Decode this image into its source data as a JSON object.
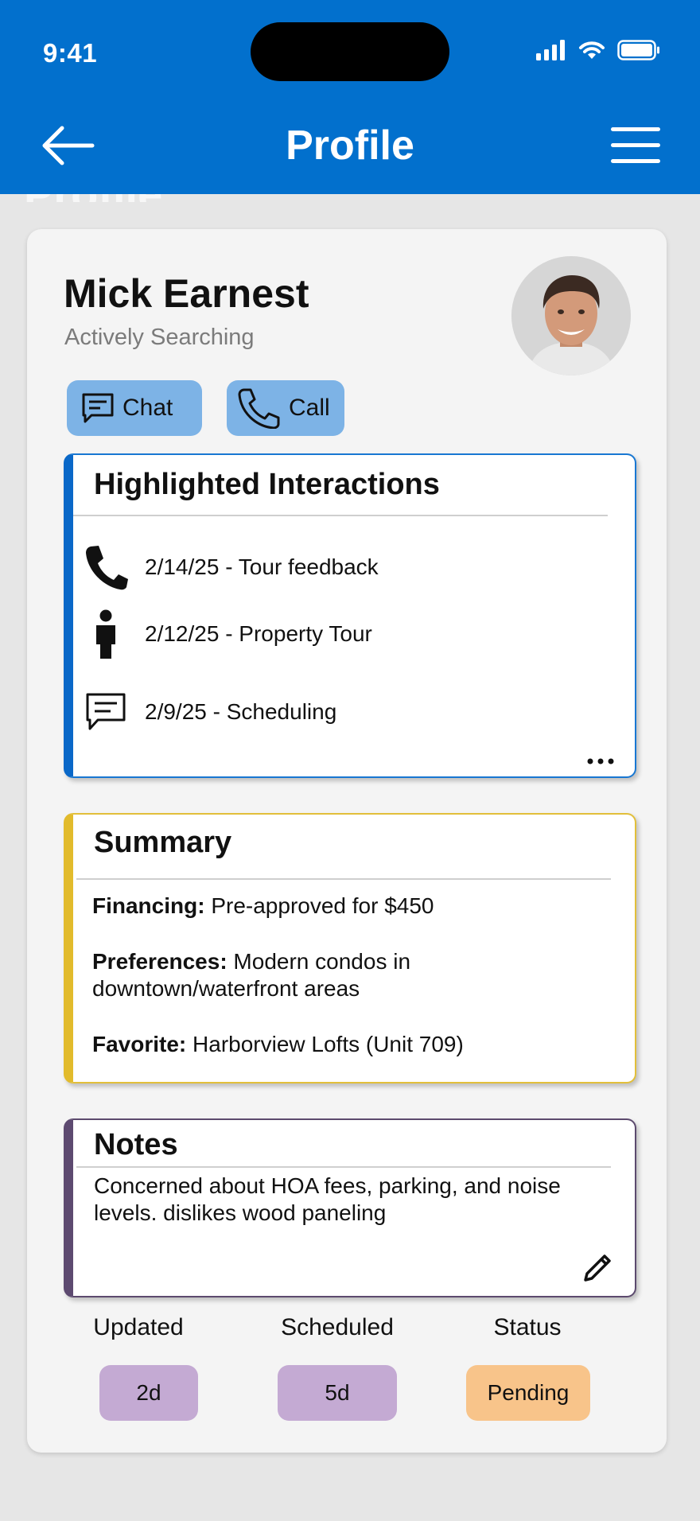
{
  "status_bar": {
    "time": "9:41"
  },
  "header": {
    "title": "Profile",
    "ghost_title": "Profile"
  },
  "profile": {
    "name": "Mick Earnest",
    "status": "Actively Searching",
    "chat_label": "Chat",
    "call_label": "Call"
  },
  "highlights": {
    "title": "Highlighted Interactions",
    "items": [
      {
        "icon": "phone-icon",
        "text": "2/14/25 - Tour feedback"
      },
      {
        "icon": "person-icon",
        "text": "2/12/25 - Property Tour"
      },
      {
        "icon": "message-icon",
        "text": "2/9/25 - Scheduling"
      }
    ]
  },
  "summary": {
    "title": "Summary",
    "financing_label": "Financing:",
    "financing_value": " Pre-approved for $450",
    "preferences_label": "Preferences:",
    "preferences_value": " Modern condos in downtown/waterfront areas",
    "favorite_label": "Favorite:",
    "favorite_value": " Harborview Lofts (Unit 709)"
  },
  "notes": {
    "title": "Notes",
    "text": "Concerned about HOA fees, parking, and noise levels. dislikes wood paneling"
  },
  "stats": {
    "updated_label": "Updated",
    "updated_value": "2d",
    "scheduled_label": "Scheduled",
    "scheduled_value": "5d",
    "status_label": "Status",
    "status_value": "Pending"
  },
  "colors": {
    "header_blue": "#0270cd",
    "button_blue": "#7db3e6",
    "highlight_accent": "#0a68c8",
    "summary_accent": "#e2bb2c",
    "notes_accent": "#5d4a70",
    "lavender": "#c4aad3",
    "peach": "#f8c48a"
  }
}
